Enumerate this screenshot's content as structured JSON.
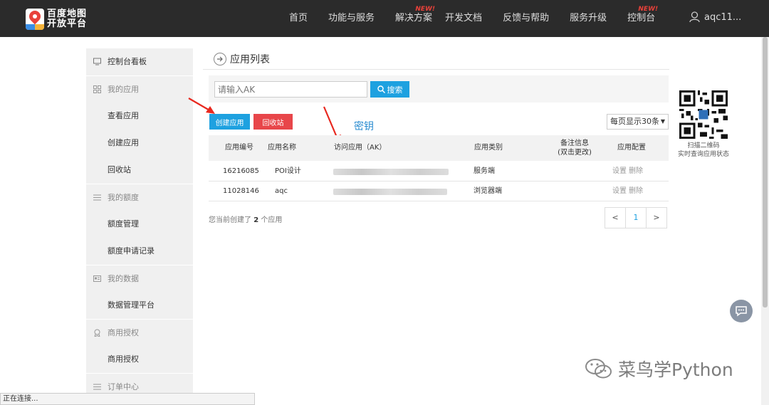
{
  "header": {
    "logo_line1": "百度地图",
    "logo_line2": "开放平台",
    "nav": [
      {
        "label": "首页"
      },
      {
        "label": "功能与服务"
      },
      {
        "label": "解决方案",
        "badge": "NEW!"
      },
      {
        "label": "开发文档"
      },
      {
        "label": "反馈与帮助"
      },
      {
        "label": "服务升级"
      },
      {
        "label": "控制台",
        "badge": "NEW!"
      }
    ],
    "user": "aqc11..."
  },
  "sidebar": {
    "items": [
      {
        "label": "控制台看板",
        "type": "group",
        "icon": "monitor-icon"
      },
      {
        "label": "我的应用",
        "type": "group",
        "icon": "grid-icon"
      },
      {
        "label": "查看应用",
        "type": "child"
      },
      {
        "label": "创建应用",
        "type": "child"
      },
      {
        "label": "回收站",
        "type": "child"
      },
      {
        "label": "我的额度",
        "type": "group",
        "icon": "list-icon"
      },
      {
        "label": "额度管理",
        "type": "child"
      },
      {
        "label": "额度申请记录",
        "type": "child"
      },
      {
        "label": "我的数据",
        "type": "group",
        "icon": "id-card-icon"
      },
      {
        "label": "数据管理平台",
        "type": "child"
      },
      {
        "label": "商用授权",
        "type": "group",
        "icon": "badge-icon"
      },
      {
        "label": "商用授权",
        "type": "child"
      },
      {
        "label": "订单中心",
        "type": "group",
        "icon": "list-icon"
      }
    ]
  },
  "main": {
    "title": "应用列表",
    "search_placeholder": "请输入AK",
    "search_label": "搜索",
    "create_label": "创建应用",
    "recycle_label": "回收站",
    "per_page": "每页显示30条",
    "annotation": "密钥",
    "table": {
      "headers": {
        "id": "应用编号",
        "name": "应用名称",
        "ak": "访问应用（AK）",
        "category": "应用类别",
        "note_line1": "备注信息",
        "note_line2": "(双击更改)",
        "config": "应用配置"
      },
      "rows": [
        {
          "id": "16216085",
          "name": "POI设计",
          "category": "服务端",
          "set": "设置",
          "del": "删除"
        },
        {
          "id": "11028146",
          "name": "aqc",
          "category": "浏览器端",
          "set": "设置",
          "del": "删除"
        }
      ]
    },
    "summary_prefix": "您当前创建了",
    "summary_count": "2",
    "summary_suffix": "个应用",
    "pager": {
      "prev": "<",
      "page": "1",
      "next": ">"
    }
  },
  "qr": {
    "line1": "扫描二维码",
    "line2": "实时查询应用状态"
  },
  "watermark": "菜鸟学Python",
  "status": "正在连接..."
}
